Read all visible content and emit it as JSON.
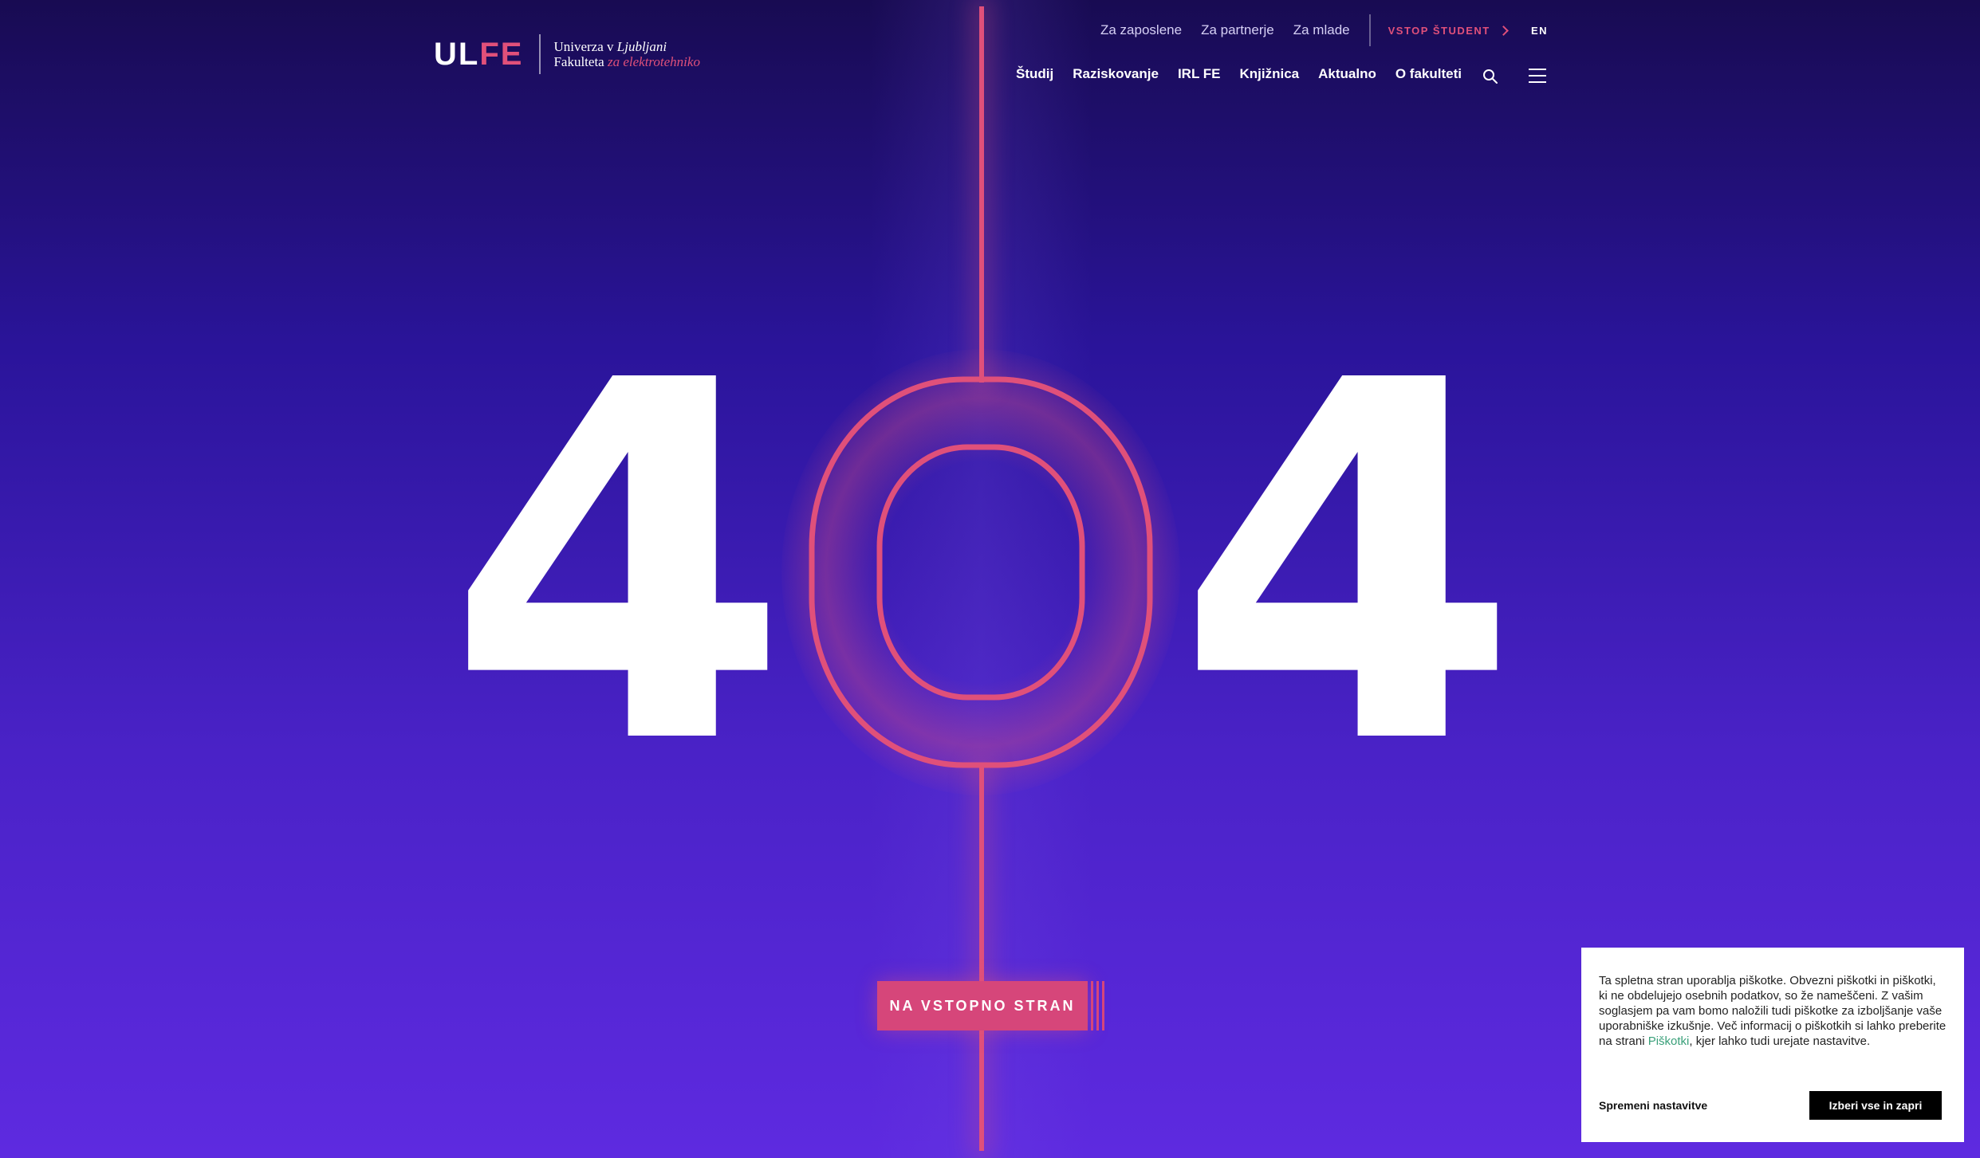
{
  "logo": {
    "mark_ul": "UL",
    "mark_fe": "FE",
    "line1_prefix": "Univerza v ",
    "line1_italic": "Ljubljani",
    "line2_prefix": "Fakulteta ",
    "line2_italic": "za elektrotehniko"
  },
  "top_nav": {
    "items": [
      "Za zaposlene",
      "Za partnerje",
      "Za mlade"
    ],
    "login_label": "VSTOP ŠTUDENT",
    "lang": "EN"
  },
  "main_nav": {
    "items": [
      "Študij",
      "Raziskovanje",
      "IRL FE",
      "Knjižnica",
      "Aktualno",
      "O fakulteti"
    ]
  },
  "hero": {
    "digit_left": "4",
    "digit_right": "4",
    "cta_label": "NA VSTOPNO STRAN"
  },
  "cookie": {
    "text_before_link": "Ta spletna stran uporablja piškotke. Obvezni piškotki in piškotki, ki ne obdelujejo osebnih podatkov, so že nameščeni. Z vašim soglasjem pa vam bomo naložili tudi piškotke za izboljšanje vaše uporabniške izkušnje. Več informacij o piškotkih si lahko preberite na strani ",
    "link_label": "Piškotki",
    "text_after_link": ", kjer lahko tudi urejate nastavitve.",
    "settings_label": "Spremeni nastavitve",
    "accept_label": "Izberi vse in zapri"
  },
  "colors": {
    "accent": "#e0507a",
    "bg_top": "#180b52",
    "bg_bottom": "#5e2ae0",
    "link_green": "#3aa07a"
  },
  "icons": {
    "search": "search-icon",
    "menu": "hamburger-menu-icon",
    "chevron": "chevron-right-icon"
  }
}
